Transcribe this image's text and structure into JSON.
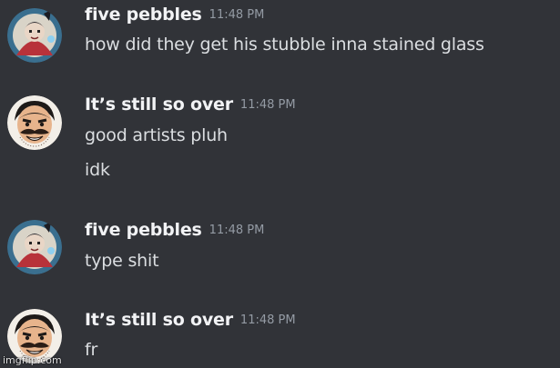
{
  "messages": [
    {
      "username": "five pebbles",
      "timestamp": "11:48 PM",
      "avatar_icon": "five-pebbles-avatar",
      "lines": [
        "how did they get his stubble inna stained glass"
      ]
    },
    {
      "username": "It’s still so over",
      "timestamp": "11:48 PM",
      "avatar_icon": "mustache-man-avatar",
      "lines": [
        "good artists pluh",
        "idk"
      ]
    },
    {
      "username": "five pebbles",
      "timestamp": "11:48 PM",
      "avatar_icon": "five-pebbles-avatar",
      "lines": [
        "type shit"
      ]
    },
    {
      "username": "It’s still so over",
      "timestamp": "11:48 PM",
      "avatar_icon": "mustache-man-avatar",
      "lines": [
        "fr"
      ]
    }
  ],
  "watermark": "imgflip.com",
  "colors": {
    "background": "#313338",
    "username": "#f2f3f5",
    "timestamp": "#949ba4",
    "message_text": "#dbdee1"
  }
}
